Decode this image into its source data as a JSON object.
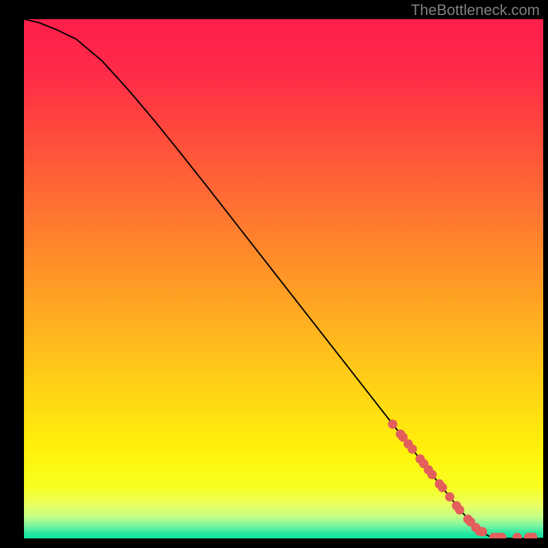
{
  "watermark": "TheBottleneck.com",
  "chart_data": {
    "type": "line",
    "title": "",
    "xlabel": "",
    "ylabel": "",
    "xlim": [
      0,
      100
    ],
    "ylim": [
      0,
      100
    ],
    "x": [
      0,
      3,
      6,
      10,
      15,
      20,
      25,
      30,
      35,
      40,
      45,
      50,
      55,
      60,
      65,
      70,
      75,
      80,
      82,
      84,
      86,
      88,
      90,
      92,
      94,
      96,
      98,
      100
    ],
    "y": [
      100,
      99.3,
      98.1,
      96.2,
      92.0,
      86.5,
      80.6,
      74.4,
      68.1,
      61.7,
      55.3,
      48.9,
      42.5,
      36.1,
      29.7,
      23.3,
      16.9,
      10.5,
      8.0,
      5.5,
      3.2,
      1.3,
      0.2,
      0.05,
      0.0,
      0.0,
      0.0,
      0.0
    ],
    "markers": {
      "note": "approximate positions of the highlighted orange dots along the curve",
      "points_x": [
        71,
        72.5,
        73,
        74,
        74.8,
        76.3,
        77,
        77.9,
        78.6,
        80,
        80.6,
        82,
        83.3,
        83.9,
        85.5,
        86,
        87,
        87.7,
        88.3,
        90.5,
        91.4,
        92,
        95,
        97.2,
        98
      ],
      "points_y": [
        22.0,
        20.1,
        19.5,
        18.2,
        17.2,
        15.3,
        14.4,
        13.2,
        12.3,
        10.5,
        9.8,
        8.0,
        6.3,
        5.5,
        3.7,
        3.2,
        2.1,
        1.4,
        1.3,
        0.2,
        0.2,
        0.2,
        0.2,
        0.2,
        0.2
      ]
    },
    "gradient_stops": [
      {
        "offset": 0.0,
        "color": "#ff1f4c"
      },
      {
        "offset": 0.1,
        "color": "#ff2a48"
      },
      {
        "offset": 0.22,
        "color": "#ff4a3c"
      },
      {
        "offset": 0.35,
        "color": "#ff6e34"
      },
      {
        "offset": 0.48,
        "color": "#ff9228"
      },
      {
        "offset": 0.6,
        "color": "#ffb41e"
      },
      {
        "offset": 0.72,
        "color": "#ffd514"
      },
      {
        "offset": 0.83,
        "color": "#fff20a"
      },
      {
        "offset": 0.9,
        "color": "#f8ff20"
      },
      {
        "offset": 0.935,
        "color": "#eaff60"
      },
      {
        "offset": 0.958,
        "color": "#c4ff86"
      },
      {
        "offset": 0.975,
        "color": "#7df5a0"
      },
      {
        "offset": 0.99,
        "color": "#28e7a2"
      },
      {
        "offset": 1.0,
        "color": "#0de3a0"
      }
    ],
    "marker_color": "#e35f5c",
    "curve_color": "#000000"
  }
}
